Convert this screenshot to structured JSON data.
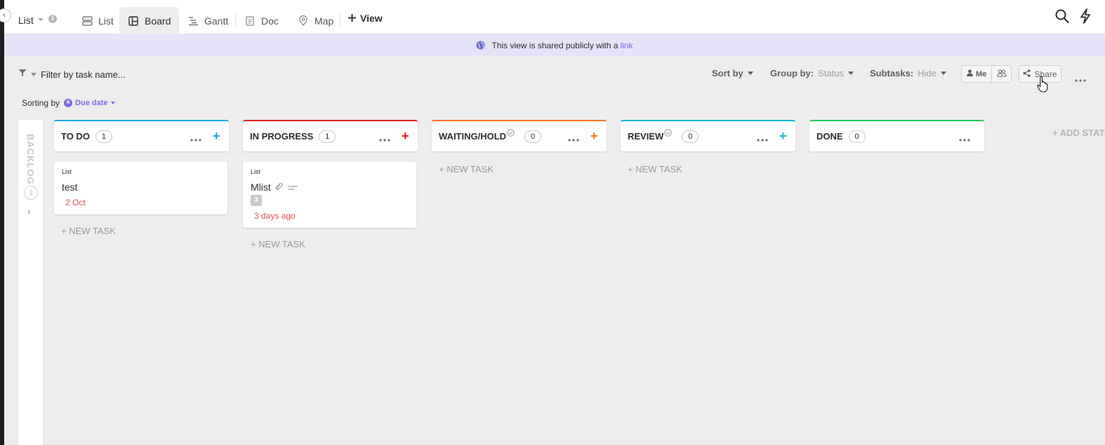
{
  "header": {
    "list_title": "List",
    "tabs": [
      {
        "label": "List",
        "icon": "list-icon"
      },
      {
        "label": "Board",
        "icon": "board-icon",
        "active": true
      },
      {
        "label": "Gantt",
        "icon": "gantt-icon"
      },
      {
        "label": "Doc",
        "icon": "doc-icon"
      },
      {
        "label": "Map",
        "icon": "map-pin-icon"
      }
    ],
    "add_view_label": "View"
  },
  "banner": {
    "text": "This view is shared publicly with a",
    "link": "link"
  },
  "toolbar": {
    "filter_placeholder": "Filter by task name...",
    "sort_label": "Sort by",
    "group_label": "Group by:",
    "group_value": "Status",
    "subtasks_label": "Subtasks:",
    "subtasks_value": "Hide",
    "me_label": "Me",
    "share_label": "Share"
  },
  "sorting": {
    "label": "Sorting by",
    "chip": "Due date"
  },
  "backlog": {
    "label": "BACKLOG",
    "count": "1"
  },
  "columns": [
    {
      "title": "TO DO",
      "count": "1",
      "color": "#0ea5e9",
      "new_task": "+ NEW TASK"
    },
    {
      "title": "IN PROGRESS",
      "count": "1",
      "color": "#e11d1d",
      "new_task": "+ NEW TASK"
    },
    {
      "title": "WAITING/HOLD",
      "count": "0",
      "color": "#f97316",
      "new_task": "+ NEW TASK"
    },
    {
      "title": "REVIEW",
      "count": "0",
      "color": "#06b6d4",
      "new_task": "+ NEW TASK"
    },
    {
      "title": "DONE",
      "count": "0",
      "color": "#22c55e"
    }
  ],
  "cards": [
    {
      "list": "List",
      "title": "test",
      "date": "2 Oct"
    },
    {
      "list": "List",
      "title": "Mlist",
      "subtasks": "3",
      "date": "3 days ago"
    }
  ],
  "add_status_label": "+ ADD STATUS"
}
